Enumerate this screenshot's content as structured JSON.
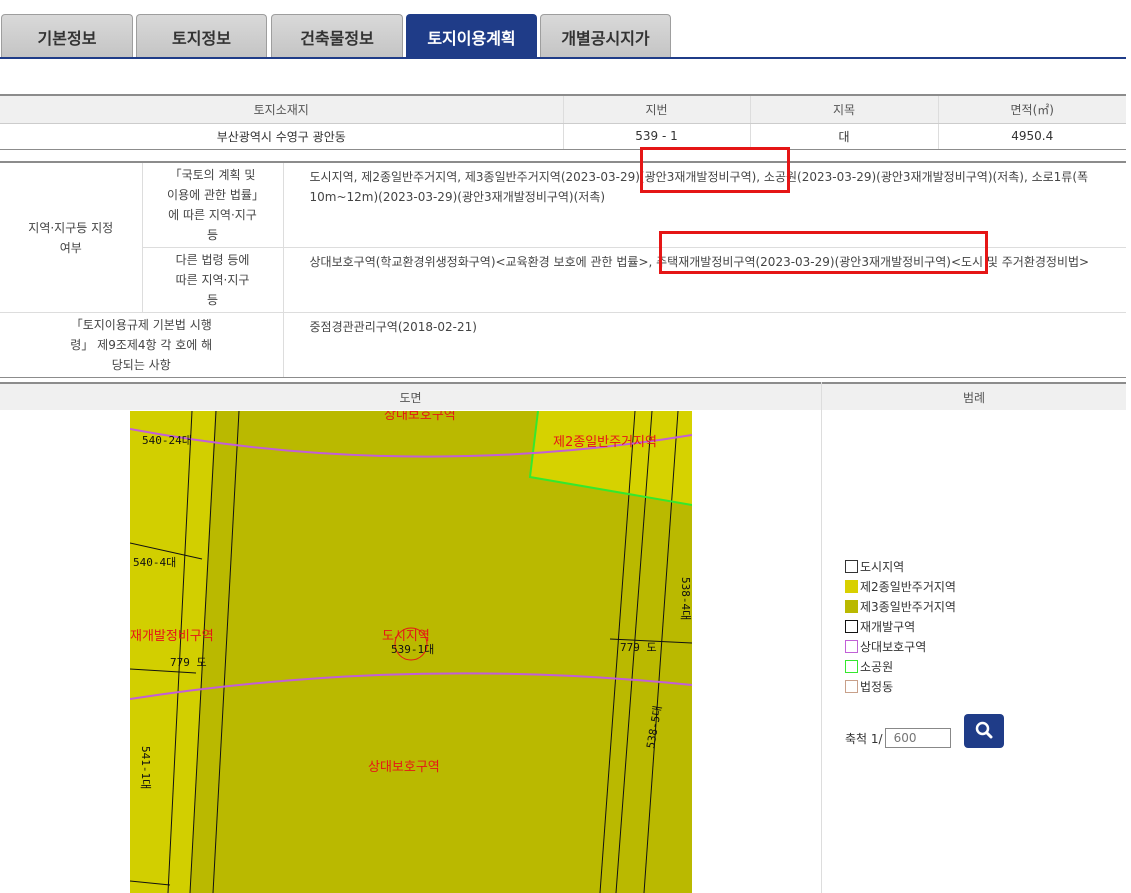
{
  "tabs": [
    {
      "label": "기본정보"
    },
    {
      "label": "토지정보"
    },
    {
      "label": "건축물정보"
    },
    {
      "label": "토지이용계획"
    },
    {
      "label": "개별공시지가"
    }
  ],
  "land_table": {
    "headers": [
      "토지소재지",
      "지번",
      "지목",
      "면적(㎡)"
    ],
    "row": [
      "부산광역시 수영구 광안동",
      "539 - 1",
      "대",
      "4950.4"
    ]
  },
  "zoning": {
    "region_label": "지역·지구등 지정여부",
    "law1_label": "「국토의 계획 및 이용에 관한 법률」에 따른 지역·지구등",
    "law1_value": "도시지역, 제2종일반주거지역, 제3종일반주거지역(2023-03-29)(광안3재개발정비구역), 소공원(2023-03-29)(광안3재개발정비구역)(저촉), 소로1류(폭10m~12m)(2023-03-29)(광안3재개발정비구역)(저촉)",
    "law2_label": "다른 법령 등에 따른 지역·지구등",
    "law2_value": "상대보호구역(학교환경위생정화구역)<교육환경 보호에 관한 법률>, 주택재개발정비구역(2023-03-29)(광안3재개발정비구역)<도시 및 주거환경정비법>",
    "article_label": "「토지이용규제 기본법 시행령」 제9조제4항 각 호에 해당되는 사항",
    "article_value": "중점경관관리구역(2018-02-21)"
  },
  "section": {
    "map_header": "도면",
    "legend_header": "범례"
  },
  "map_labels": {
    "top_zone": "상대보호구역",
    "zone2": "제2종일반주거지역",
    "lot_540_24": "540-24대",
    "lot_540_4": "540-4대",
    "redev": "재개발정비구역",
    "road_779_left": "779 도",
    "urban": "도시지역",
    "lot_539_1": "539-1대",
    "road_779_right": "779 도",
    "lot_538_4": "538-4대",
    "lot_541_1": "541-1대",
    "protect": "상대보호구역",
    "lot_538_5": "538-5대"
  },
  "legend": [
    {
      "label": "도시지역",
      "color": "#ffffff"
    },
    {
      "label": "제2종일반주거지역",
      "color": "#d8d000"
    },
    {
      "label": "제3종일반주거지역",
      "color": "#bab900"
    },
    {
      "label": "재개발구역",
      "color": "#ffffff"
    },
    {
      "label": "상대보호구역",
      "color": "#ffffff"
    },
    {
      "label": "소공원",
      "color": "#ffffff"
    },
    {
      "label": "법정동",
      "color": "#ffffff"
    }
  ],
  "scale": {
    "label": "축척 1/",
    "placeholder": "600"
  }
}
